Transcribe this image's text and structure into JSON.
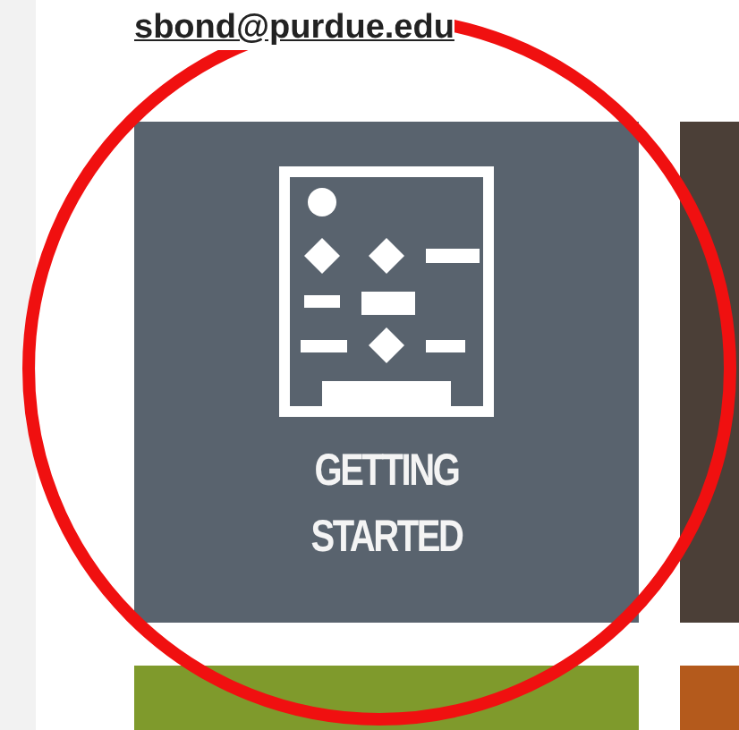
{
  "email": "sbond@purdue.edu",
  "tiles": [
    {
      "label": "GETTING STARTED",
      "color": "#59636e"
    },
    {
      "color": "#4b3f37"
    },
    {
      "color": "#7f9a2c"
    },
    {
      "color": "#b45a1c"
    }
  ]
}
